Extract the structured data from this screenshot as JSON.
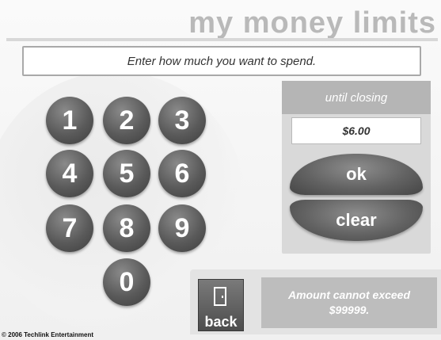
{
  "header": {
    "title": "my money limits"
  },
  "prompt": "Enter how much you want to spend.",
  "keypad": {
    "keys": [
      "1",
      "2",
      "3",
      "4",
      "5",
      "6",
      "7",
      "8",
      "9",
      "0"
    ]
  },
  "limit_panel": {
    "heading": "until closing",
    "value": "$6.00",
    "ok_label": "ok",
    "clear_label": "clear"
  },
  "footer": {
    "back_label": "back",
    "warning_line1": "Amount cannot exceed",
    "warning_line2": "$99999.",
    "copyright": "© 2006 Techlink Entertainment"
  },
  "icons": {
    "back": "door-icon"
  },
  "colors": {
    "button": "#5a5a5a",
    "panel": "#d9d9d9",
    "panel_header": "#b5b5b5",
    "title": "#b9b9b9"
  }
}
